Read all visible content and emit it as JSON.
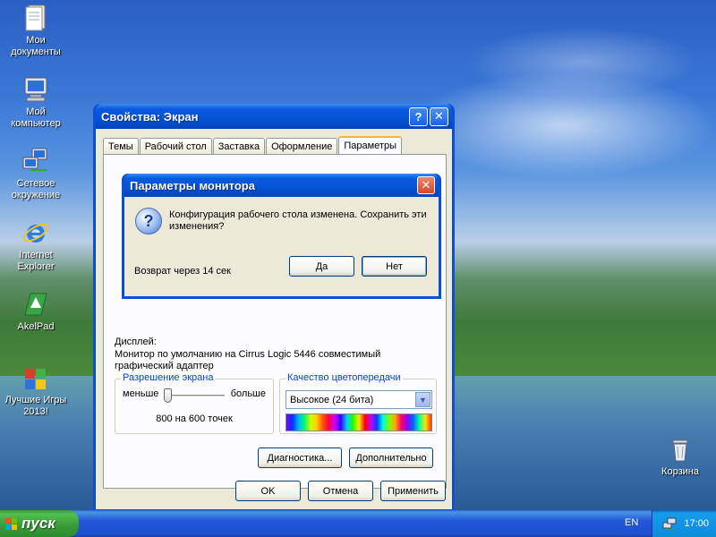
{
  "desktop": {
    "icons": [
      {
        "label": "Мои документы"
      },
      {
        "label": "Мой компьютер"
      },
      {
        "label": "Сетевое окружение"
      },
      {
        "label": "Internet Explorer"
      },
      {
        "label": "AkelPad"
      },
      {
        "label": "Лучшие Игры 2013!"
      },
      {
        "label": "Корзина"
      }
    ]
  },
  "window": {
    "title": "Свойства: Экран",
    "help_glyph": "?",
    "close_glyph": "✕",
    "tabs": [
      "Темы",
      "Рабочий стол",
      "Заставка",
      "Оформление",
      "Параметры"
    ],
    "active_tab": "Параметры",
    "display_label": "Дисплей:",
    "display_value": "Монитор по умолчанию на Cirrus Logic 5446 совместимый графический адаптер",
    "resolution": {
      "group_title": "Разрешение экрана",
      "less": "меньше",
      "more": "больше",
      "value": "800 на 600 точек",
      "slider_level": 0.0
    },
    "color_quality": {
      "group_title": "Качество цветопередачи",
      "selected": "Высокое (24 бита)"
    },
    "buttons": {
      "troubleshoot": "Диагностика...",
      "advanced": "Дополнительно",
      "ok": "OK",
      "cancel": "Отмена",
      "apply": "Применить"
    }
  },
  "dialog": {
    "title": "Параметры монитора",
    "close_glyph": "✕",
    "message": "Конфигурация рабочего стола изменена. Сохранить эти изменения?",
    "countdown": "Возврат через 14 сек",
    "yes": "Да",
    "no": "Нет"
  },
  "taskbar": {
    "start_label": "пуск",
    "language": "EN",
    "clock": "17:00"
  },
  "colors": {
    "xp_blue": "#0a4fd6",
    "dialog_face": "#ece9d8",
    "group_title": "#0046d5",
    "start_green": "#3c9a3c"
  }
}
